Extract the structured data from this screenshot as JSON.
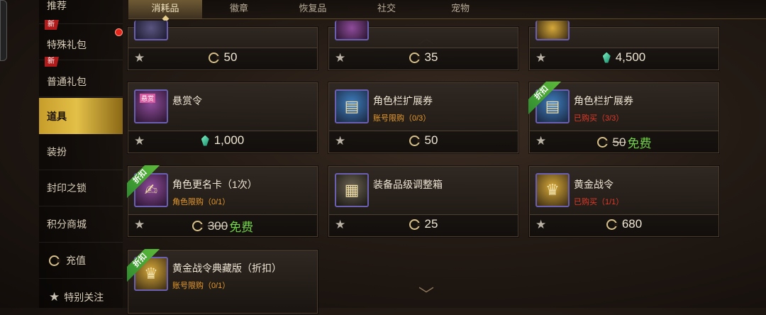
{
  "sidebar": {
    "items": [
      {
        "label": "推荐"
      },
      {
        "label": "特殊礼包",
        "tag": "新"
      },
      {
        "label": "普通礼包",
        "tag": "新"
      },
      {
        "label": "道具"
      },
      {
        "label": "装扮"
      },
      {
        "label": "封印之锁"
      },
      {
        "label": "积分商城"
      },
      {
        "label": "充值"
      },
      {
        "label": "特别关注"
      }
    ]
  },
  "tabs": [
    "消耗品",
    "徽章",
    "恢复品",
    "社交",
    "宠物"
  ],
  "cards": [
    {
      "name": "",
      "limit": "",
      "price": "50",
      "currency": "coin-icon"
    },
    {
      "name": "",
      "limit": "",
      "price": "35",
      "currency": "coin-icon"
    },
    {
      "name": "",
      "limit": "",
      "price": "4,500",
      "currency": "gem-icon"
    },
    {
      "name": "悬赏令",
      "limit": "",
      "price": "1,000",
      "currency": "gem-icon",
      "icon_text": "悬赏"
    },
    {
      "name": "角色栏扩展券",
      "limit": "账号限购（0/3）",
      "price": "50",
      "currency": "coin-icon"
    },
    {
      "name": "角色栏扩展券",
      "limit": "已购买（3/3）",
      "old_price": "50",
      "price": "免费",
      "currency": "coin-icon",
      "discount": "折扣"
    },
    {
      "name": "角色更名卡（1次）",
      "limit": "角色限购（0/1）",
      "old_price": "300",
      "price": "免费",
      "currency": "coin-icon",
      "discount": "折扣"
    },
    {
      "name": "装备品级调整箱",
      "limit": "",
      "price": "25",
      "currency": "coin-icon"
    },
    {
      "name": "黄金战令",
      "limit": "已购买（1/1）",
      "price": "680",
      "currency": "coin-icon"
    },
    {
      "name": "黄金战令典藏版（折扣）",
      "limit": "账号限购（0/1）",
      "price": "",
      "currency": "coin-icon",
      "discount": "折扣"
    }
  ],
  "colors": {
    "accent": "#e3c048",
    "free": "#73d34a",
    "limit_orange": "#e79a2c",
    "limit_red": "#e23a2a"
  }
}
